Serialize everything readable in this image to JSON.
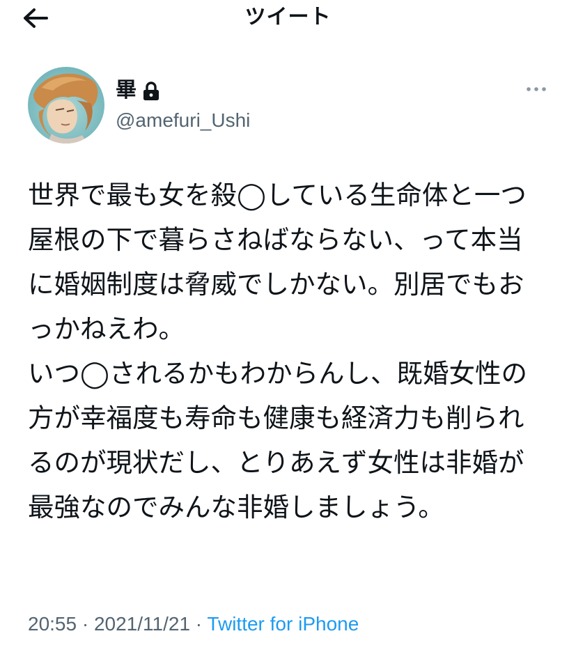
{
  "header": {
    "title": "ツイート",
    "back_icon": "arrow-left-icon"
  },
  "author": {
    "display_name": "畢",
    "handle": "@amefuri_Ushi",
    "protected_icon": "lock-icon",
    "avatar_icon": "avatar"
  },
  "tweet": {
    "text": "世界で最も女を殺◯している生命体と一つ屋根の下で暮らさねばならない、って本当に婚姻制度は脅威でしかない。別居でもおっかねえわ。\nいつ◯されるかもわからんし、既婚女性の方が幸福度も寿命も健康も経済力も削られるのが現状だし、とりあえず女性は非婚が最強なのでみんな非婚しましょう。",
    "time": "20:55",
    "date": "2021/11/21",
    "separator": " · ",
    "source": "Twitter for iPhone"
  },
  "colors": {
    "text": "#0f1419",
    "secondary": "#536471",
    "link": "#1d9bf0",
    "background": "#ffffff"
  }
}
